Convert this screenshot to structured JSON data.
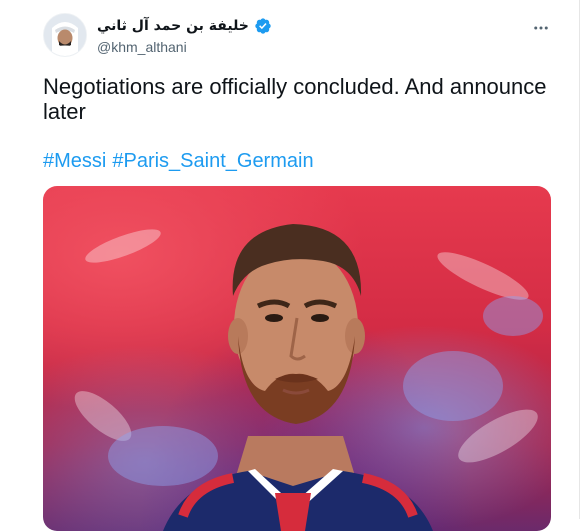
{
  "tweet": {
    "author": {
      "display_name": "خليفة بن حمد آل ثاني",
      "handle": "@khm_althani",
      "verified": true,
      "avatar_icon": "profile-photo"
    },
    "more_icon": "ellipsis-icon",
    "text": "Negotiations are officially concluded. And announce later",
    "hashtags": [
      "#Messi",
      "#Paris_Saint_Germain"
    ],
    "media": {
      "kind": "photo",
      "icon": "player-portrait"
    }
  },
  "colors": {
    "text": "#0f1419",
    "secondary": "#536471",
    "link": "#1d9bf0",
    "verified_badge": "#1d9bf0",
    "background_red": "#e63a4e"
  }
}
